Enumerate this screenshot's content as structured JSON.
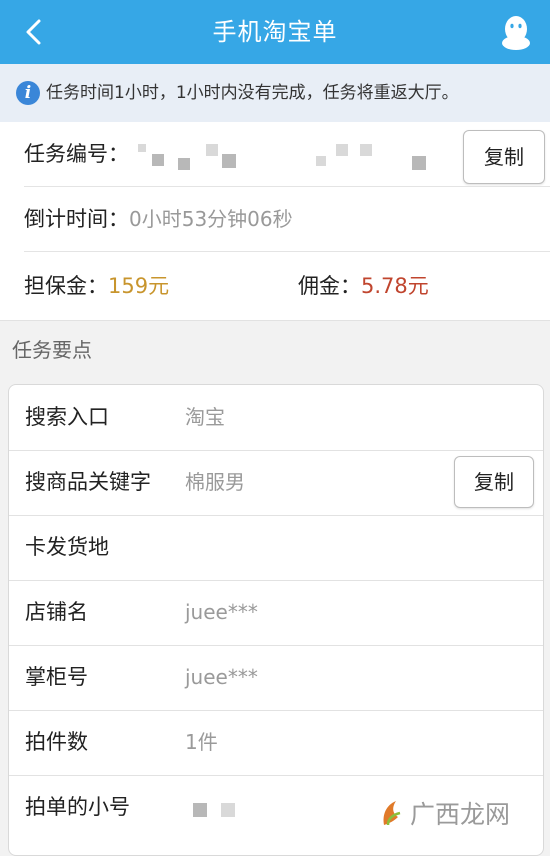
{
  "header": {
    "title": "手机淘宝单"
  },
  "notice": {
    "text": "任务时间1小时，1小时内没有完成，任务将重返大厅。"
  },
  "task": {
    "number_label": "任务编号：",
    "copy_label": "复制",
    "countdown_label": "倒计时间：",
    "countdown_value": "0小时53分钟06秒",
    "deposit_label": "担保金：",
    "deposit_value": "159元",
    "commission_label": "佣金：",
    "commission_value": "5.78元"
  },
  "section": {
    "title": "任务要点"
  },
  "points": [
    {
      "label": "搜索入口",
      "value": "淘宝"
    },
    {
      "label": "搜商品关键字",
      "value": "棉服男",
      "copy_label": "复制"
    },
    {
      "label": "卡发货地",
      "value": ""
    },
    {
      "label": "店铺名",
      "value": "juee***"
    },
    {
      "label": "掌柜号",
      "value": "juee***"
    },
    {
      "label": "拍件数",
      "value": "1件"
    },
    {
      "label": "拍单的小号",
      "value": ""
    }
  ],
  "watermark": {
    "text": "广西龙网"
  },
  "colors": {
    "header": "#36a7e6",
    "deposit": "#c8952d",
    "commission": "#c0452e"
  }
}
